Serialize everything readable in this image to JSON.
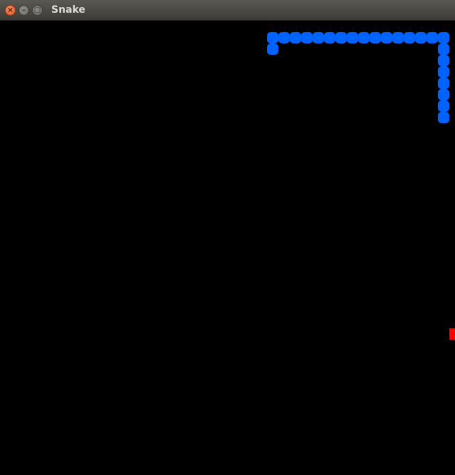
{
  "window": {
    "title": "Snake",
    "close_glyph": "×",
    "minimize_glyph": "–",
    "maximize_glyph": "□"
  },
  "colors": {
    "snake": "#0063ff",
    "food": "#ff0000",
    "background": "#000000"
  },
  "snake": {
    "segments": [
      [
        23,
        2
      ],
      [
        23,
        1
      ],
      [
        24,
        1
      ],
      [
        25,
        1
      ],
      [
        26,
        1
      ],
      [
        27,
        1
      ],
      [
        28,
        1
      ],
      [
        29,
        1
      ],
      [
        30,
        1
      ],
      [
        31,
        1
      ],
      [
        32,
        1
      ],
      [
        33,
        1
      ],
      [
        34,
        1
      ],
      [
        35,
        1
      ],
      [
        36,
        1
      ],
      [
        37,
        1
      ],
      [
        38,
        1
      ],
      [
        38,
        2
      ],
      [
        38,
        3
      ],
      [
        38,
        4
      ],
      [
        38,
        5
      ],
      [
        38,
        6
      ],
      [
        38,
        7
      ],
      [
        38,
        8
      ]
    ]
  },
  "food": {
    "cell": [
      39,
      27
    ]
  }
}
